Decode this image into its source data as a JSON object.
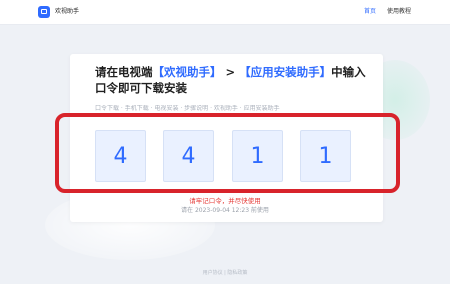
{
  "header": {
    "app_name": "欢视助手",
    "nav": [
      "首页",
      "使用教程"
    ]
  },
  "main": {
    "title_prefix": "请在电视端",
    "title_hl1": "【欢视助手】",
    "title_mid": " > ",
    "title_hl2": "【应用安装助手】",
    "title_suffix": "中输入口令即可下载安装",
    "subline": "口令下载 · 手机下载 · 电视安装 · 步骤说明 · 欢视助手 · 应用安装助手",
    "code": [
      "4",
      "4",
      "1",
      "1"
    ],
    "hint": "请牢记口令，并尽快使用",
    "validity": "请在 2023-09-04 12:23 前使用"
  },
  "footer": {
    "text": "用户协议 | 隐私政策"
  },
  "colors": {
    "accent": "#2f6bff",
    "highlight_frame": "#d8232b",
    "hint": "#e53935"
  }
}
